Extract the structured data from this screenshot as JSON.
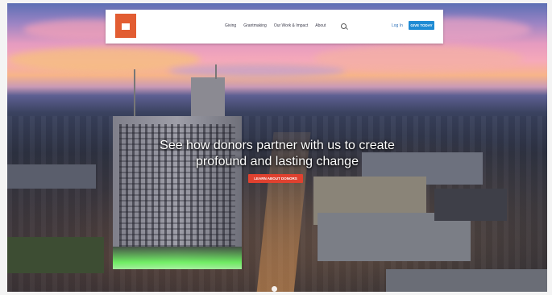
{
  "nav": {
    "logo_text": "",
    "links": [
      "Giving",
      "Grantmaking",
      "Our Work & Impact",
      "About"
    ],
    "login_label": "Log In",
    "give_label": "GIVE TODAY"
  },
  "hero": {
    "title": "See how donors partner with us to create profound and lasting change",
    "cta_label": "LEARN ABOUT DONORS"
  },
  "colors": {
    "give_button": "#1f8bd4",
    "cta_button": "#e0412f",
    "logo": "#e25d32"
  },
  "icons": [
    "search-icon"
  ]
}
